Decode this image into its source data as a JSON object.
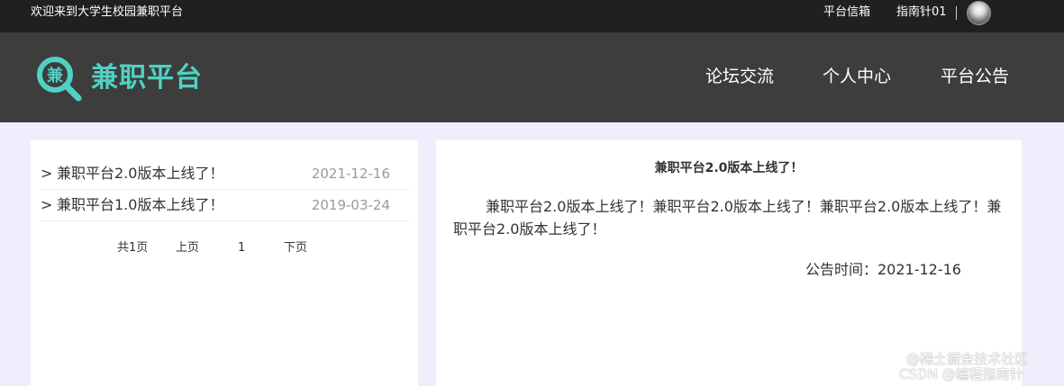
{
  "topbar": {
    "welcome": "欢迎来到大学生校园兼职平台",
    "inbox": "平台信箱",
    "username": "指南针01"
  },
  "header": {
    "logo_glyph": "兼",
    "logo_text": "兼职平台",
    "nav": [
      "论坛交流",
      "个人中心",
      "平台公告"
    ]
  },
  "notices": [
    {
      "arrow": ">",
      "title": "兼职平台2.0版本上线了！",
      "date": "2021-12-16"
    },
    {
      "arrow": ">",
      "title": "兼职平台1.0版本上线了！",
      "date": "2019-03-24"
    }
  ],
  "pagination": {
    "total": "共1页",
    "prev": "上页",
    "current": "1",
    "next": "下页"
  },
  "detail": {
    "title": "兼职平台2.0版本上线了！",
    "body": "兼职平台2.0版本上线了！兼职平台2.0版本上线了！兼职平台2.0版本上线了！兼职平台2.0版本上线了！",
    "time": "公告时间：2021-12-16"
  },
  "watermark": {
    "line1": "@稀土掘金技术社区",
    "line2": "CSDN @编程指南针"
  },
  "colors": {
    "topbar_bg": "#1f2022",
    "header_bg": "#3d3d3d",
    "brand": "#4fd2c3",
    "page_bg": "#f0eefc"
  }
}
